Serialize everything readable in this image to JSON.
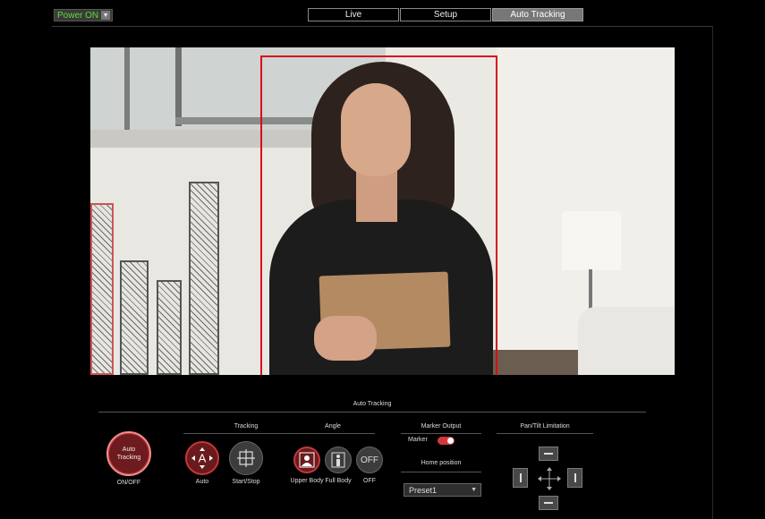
{
  "top": {
    "power_label": "Power ON",
    "tabs": [
      {
        "label": "Live",
        "active": false
      },
      {
        "label": "Setup",
        "active": false
      },
      {
        "label": "Auto Tracking",
        "active": true
      }
    ]
  },
  "panel": {
    "title": "Auto Tracking",
    "onoff": {
      "button_text": "Auto Tracking",
      "caption": "ON/OFF"
    },
    "tracking": {
      "title": "Tracking",
      "auto_label": "Auto",
      "startstop_label": "Start/Stop"
    },
    "angle": {
      "title": "Angle",
      "upper_body_label": "Upper Body",
      "full_body_label": "Full Body",
      "off_label": "OFF",
      "off_button_text": "OFF"
    },
    "marker_output": {
      "title": "Marker Output",
      "marker_label": "Marker",
      "marker_on": true
    },
    "home_position": {
      "title": "Home position",
      "selected": "Preset1"
    },
    "pan_tilt": {
      "title": "Pan/Tilt Limitation"
    }
  },
  "colors": {
    "accent_red": "#d4373b",
    "tracking_box": "#d80e1a",
    "power_green": "#5fdc35"
  }
}
